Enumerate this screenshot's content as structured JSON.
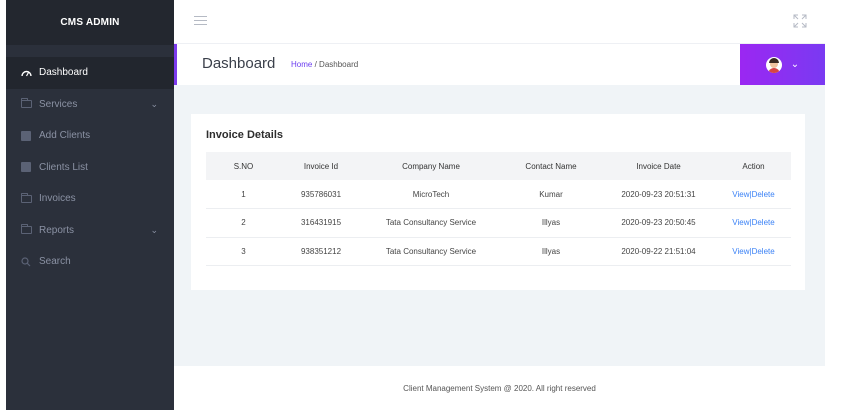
{
  "sidebar": {
    "brand": "CMS ADMIN",
    "items": [
      {
        "label": "Dashboard",
        "icon": "dashboard-icon",
        "active": true
      },
      {
        "label": "Services",
        "icon": "folder-icon",
        "has_submenu": true
      },
      {
        "label": "Add Clients",
        "icon": "square-icon"
      },
      {
        "label": "Clients List",
        "icon": "square-icon"
      },
      {
        "label": "Invoices",
        "icon": "folder-icon"
      },
      {
        "label": "Reports",
        "icon": "folder-icon",
        "has_submenu": true
      },
      {
        "label": "Search",
        "icon": "search-icon"
      }
    ],
    "submenu_caret": "⌄"
  },
  "header": {
    "title": "Dashboard",
    "breadcrumb": {
      "home": "Home",
      "separator": "/",
      "current": "Dashboard"
    },
    "user_caret": "⌄"
  },
  "invoices": {
    "title": "Invoice Details",
    "columns": [
      "S.NO",
      "Invoice Id",
      "Company Name",
      "Contact Name",
      "Invoice Date",
      "Action"
    ],
    "rows": [
      {
        "sno": "1",
        "invoice_id": "935786031",
        "company": "MicroTech",
        "contact": "Kumar",
        "date": "2020-09-23 20:51:31",
        "view": "View",
        "sep": "|",
        "delete": "Delete"
      },
      {
        "sno": "2",
        "invoice_id": "316431915",
        "company": "Tata Consultancy Service",
        "contact": "Illyas",
        "date": "2020-09-23 20:50:45",
        "view": "View",
        "sep": "|",
        "delete": "Delete"
      },
      {
        "sno": "3",
        "invoice_id": "938351212",
        "company": "Tata Consultancy Service",
        "contact": "Illyas",
        "date": "2020-09-22 21:51:04",
        "view": "View",
        "sep": "|",
        "delete": "Delete"
      }
    ]
  },
  "footer": {
    "text": "Client Management System @ 2020. All right reserved"
  },
  "colors": {
    "sidebar_bg": "#2b303b",
    "accent": "#7c3aed",
    "link": "#3b82f6",
    "content_bg": "#f0f4f7"
  }
}
